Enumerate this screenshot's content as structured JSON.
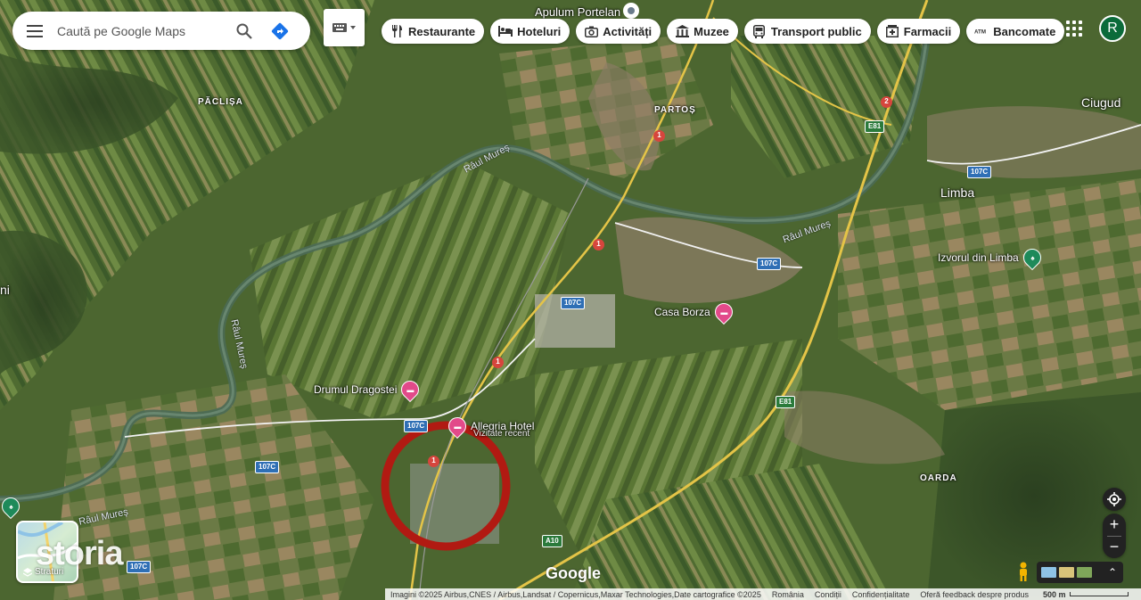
{
  "search": {
    "placeholder": "Caută pe Google Maps"
  },
  "chips": [
    {
      "label": "Restaurante",
      "icon": "fork-knife-icon"
    },
    {
      "label": "Hoteluri",
      "icon": "bed-icon"
    },
    {
      "label": "Activități",
      "icon": "camera-icon"
    },
    {
      "label": "Muzee",
      "icon": "museum-icon"
    },
    {
      "label": "Transport public",
      "icon": "bus-icon"
    },
    {
      "label": "Farmacii",
      "icon": "pharmacy-icon"
    },
    {
      "label": "Bancomate",
      "icon": "atm-icon"
    }
  ],
  "account": {
    "initial": "R",
    "color": "#0b6b3a"
  },
  "map": {
    "places": {
      "apulum": "Apulum Portelan",
      "paclisa": "PĂCLIȘA",
      "partos": "PARTOȘ",
      "ciugud": "Ciugud",
      "limba": "Limba",
      "oarda": "OARDA",
      "left_cut": "ni"
    },
    "rivers": [
      "Râul Mureș",
      "Râul Mureș",
      "Râul Mureș",
      "Râul Mureș"
    ],
    "road_shields": {
      "r1": "1",
      "a10": "A10",
      "e81": "E81",
      "r107c": "107C",
      "r2": "2"
    },
    "pois": {
      "casa_borza": "Casa Borza",
      "drumul": "Drumul Dragostei",
      "allegria": "Allegria Hotel",
      "allegria_sub": "Vizitate recent",
      "izvorul": "Izvorul din Limba"
    },
    "highlight_color": "#b11a12"
  },
  "layers": {
    "label": "Straturi"
  },
  "watermark": "storia",
  "google_logo": "Google",
  "footer": {
    "imagery": "Imagini ©2025 Airbus,CNES / Airbus,Landsat / Copernicus,Maxar Technologies,Date cartografice ©2025",
    "country": "România",
    "terms": "Condiții",
    "privacy": "Confidențialitate",
    "feedback": "Oferă feedback despre produs",
    "scale": "500 m"
  }
}
